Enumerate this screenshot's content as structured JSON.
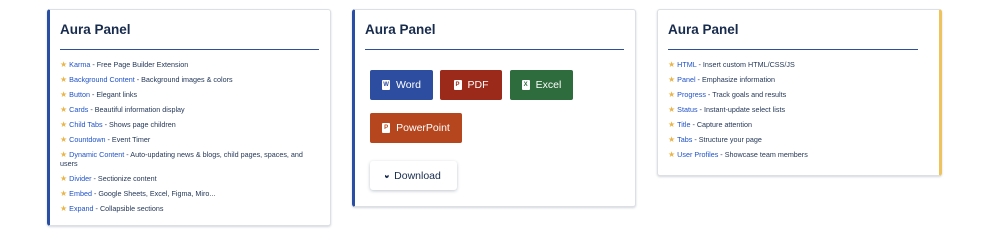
{
  "panels": [
    {
      "title": "Aura Panel",
      "items": [
        {
          "link": "Karma",
          "desc": " - Free Page Builder Extension"
        },
        {
          "link": "Background Content",
          "desc": " - Background images & colors"
        },
        {
          "link": "Button",
          "desc": " - Elegant links"
        },
        {
          "link": "Cards",
          "desc": " - Beautiful information display"
        },
        {
          "link": "Child Tabs",
          "desc": " - Shows page children"
        },
        {
          "link": "Countdown",
          "desc": " - Event Timer"
        },
        {
          "link": "Dynamic Content",
          "desc": " - Auto-updating news & blogs, child pages, spaces, and users"
        },
        {
          "link": "Divider",
          "desc": " - Sectionize content"
        },
        {
          "link": "Embed",
          "desc": " - Google Sheets, Excel, Figma, Miro..."
        },
        {
          "link": "Expand",
          "desc": " - Collapsible sections"
        }
      ]
    },
    {
      "title": "Aura Panel",
      "buttons": {
        "word": "Word",
        "pdf": "PDF",
        "excel": "Excel",
        "powerpoint": "PowerPoint",
        "download": "Download"
      }
    },
    {
      "title": "Aura Panel",
      "items": [
        {
          "link": "HTML",
          "desc": " - Insert custom HTML/CSS/JS"
        },
        {
          "link": "Panel",
          "desc": " - Emphasize information"
        },
        {
          "link": "Progress",
          "desc": " - Track goals and results"
        },
        {
          "link": "Status",
          "desc": " - Instant-update select lists"
        },
        {
          "link": "Title",
          "desc": " - Capture attention"
        },
        {
          "link": "Tabs",
          "desc": " - Structure your page"
        },
        {
          "link": "User Profiles",
          "desc": " - Showcase team members"
        }
      ]
    }
  ],
  "icons": {
    "star": "star-icon",
    "word": "word-file-icon",
    "pdf": "pdf-file-icon",
    "excel": "excel-file-icon",
    "powerpoint": "powerpoint-file-icon",
    "download": "double-chevron-down-icon"
  },
  "colors": {
    "accent_blue": "#2a4ea3",
    "accent_yellow": "#eec35c",
    "link": "#1f52c8",
    "word": "#2d4ea0",
    "pdf": "#9c2a1a",
    "excel": "#2e6b3d",
    "powerpoint": "#b6461d"
  }
}
